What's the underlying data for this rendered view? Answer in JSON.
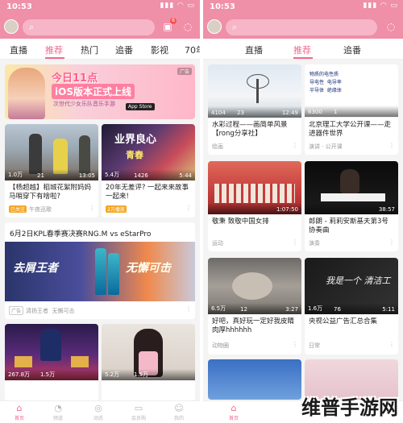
{
  "status": {
    "time": "10:53",
    "signal": "▮▮▮ ◠ ▭"
  },
  "left": {
    "badge": "6",
    "tabs": [
      "直播",
      "推荐",
      "热门",
      "追番",
      "影视",
      "70年"
    ],
    "banner": {
      "line1": "今日11点",
      "line2": "iOS版本正式上线",
      "line3": "次世代少女乐队音乐手游",
      "store": "App Store",
      "ad": "广告"
    },
    "cards": [
      {
        "views": "1.0万",
        "danmaku": "21",
        "duration": "13:05",
        "title": "【杨超越】稻城花絮附妈妈马哨穿下有啥啦?",
        "tag": "已关注",
        "meta": "午夜迅歌"
      },
      {
        "views": "5.4万",
        "danmaku": "1426",
        "duration": "5:44",
        "title": "20年无差评? 一起来来故事一起来!",
        "tag": "2万播放",
        "meta": ""
      },
      {
        "views": "267.8万",
        "danmaku": "1.5万",
        "duration": "",
        "title": "",
        "tag": "",
        "meta": ""
      },
      {
        "views": "5.2万",
        "danmaku": "1.5万",
        "duration": "",
        "title": "",
        "tag": "",
        "meta": ""
      }
    ],
    "wide": {
      "title": "6月2日KPL春季赛决赛RNG.M  vs  eStarPro",
      "img_left": "去屑王者",
      "img_right": "无懈可击",
      "tag": "广告",
      "meta1": "清扬王者",
      "meta2": "无懈可击"
    },
    "nav": [
      {
        "icon": "⌂",
        "label": "首页"
      },
      {
        "icon": "◔",
        "label": "频道"
      },
      {
        "icon": "◎",
        "label": "动态"
      },
      {
        "icon": "▭",
        "label": "会员购"
      },
      {
        "icon": "☺",
        "label": "我的"
      }
    ]
  },
  "right": {
    "tabs": [
      "直播",
      "推荐",
      "追番"
    ],
    "cards": [
      {
        "views": "4104",
        "danmaku": "23",
        "duration": "12:49",
        "title": "水彩过程——画简单风景【rong分享社】",
        "meta": "绘画"
      },
      {
        "views": "6300",
        "danmaku": "1",
        "duration": "",
        "title": "北京理工大学公开课——走进器件世界",
        "meta": "演讲 · 公开课"
      },
      {
        "views": "",
        "danmaku": "",
        "duration": "1:07:50",
        "title": "敬秉 致敬中国女排",
        "meta": "运动"
      },
      {
        "views": "",
        "danmaku": "",
        "duration": "38:57",
        "title": "郎朗 - 莉莉安斯基夫第3号协奏曲",
        "meta": "演奏"
      },
      {
        "views": "6.5万",
        "danmaku": "12",
        "duration": "3:27",
        "title": "好吧，真好玩一定好我皮睛肉厚hhhhhh",
        "meta": "动物圈"
      },
      {
        "views": "1.6万",
        "danmaku": "76",
        "duration": "5:11",
        "title": "央视公益广告汇总合集",
        "meta": "日常"
      }
    ],
    "screen_text": "物质的电性质\n导电性  电导率\n半导体  绝缘体",
    "handwriting": "我是一个  清洁工",
    "nav": [
      {
        "icon": "⌂",
        "label": "首页"
      }
    ]
  },
  "watermark": "维普手游网"
}
